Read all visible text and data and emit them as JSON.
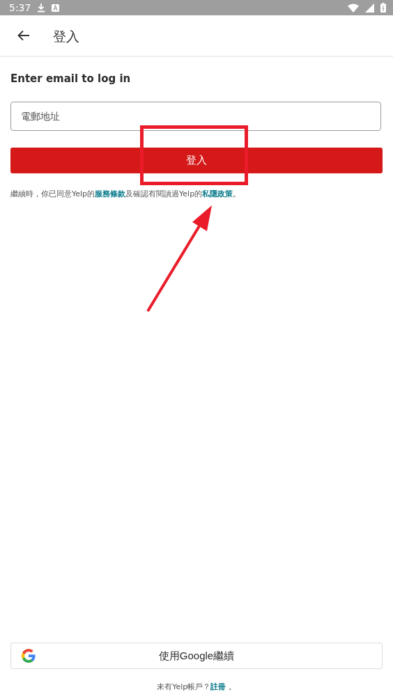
{
  "status_bar": {
    "time": "5:37"
  },
  "app_bar": {
    "title": "登入"
  },
  "heading": "Enter email to log in",
  "email_field": {
    "placeholder": "電郵地址"
  },
  "login_button": "登入",
  "terms": {
    "before": "繼續時，你已同意Yelp的",
    "link_1": "服務條款",
    "middle": "及確認有閱讀過Yelp的",
    "link_2": "私隱政策",
    "after": "。"
  },
  "google_button": "使用Google繼續",
  "signup": {
    "text": "未有Yelp帳戶？",
    "link": "註冊",
    "after": "。"
  }
}
